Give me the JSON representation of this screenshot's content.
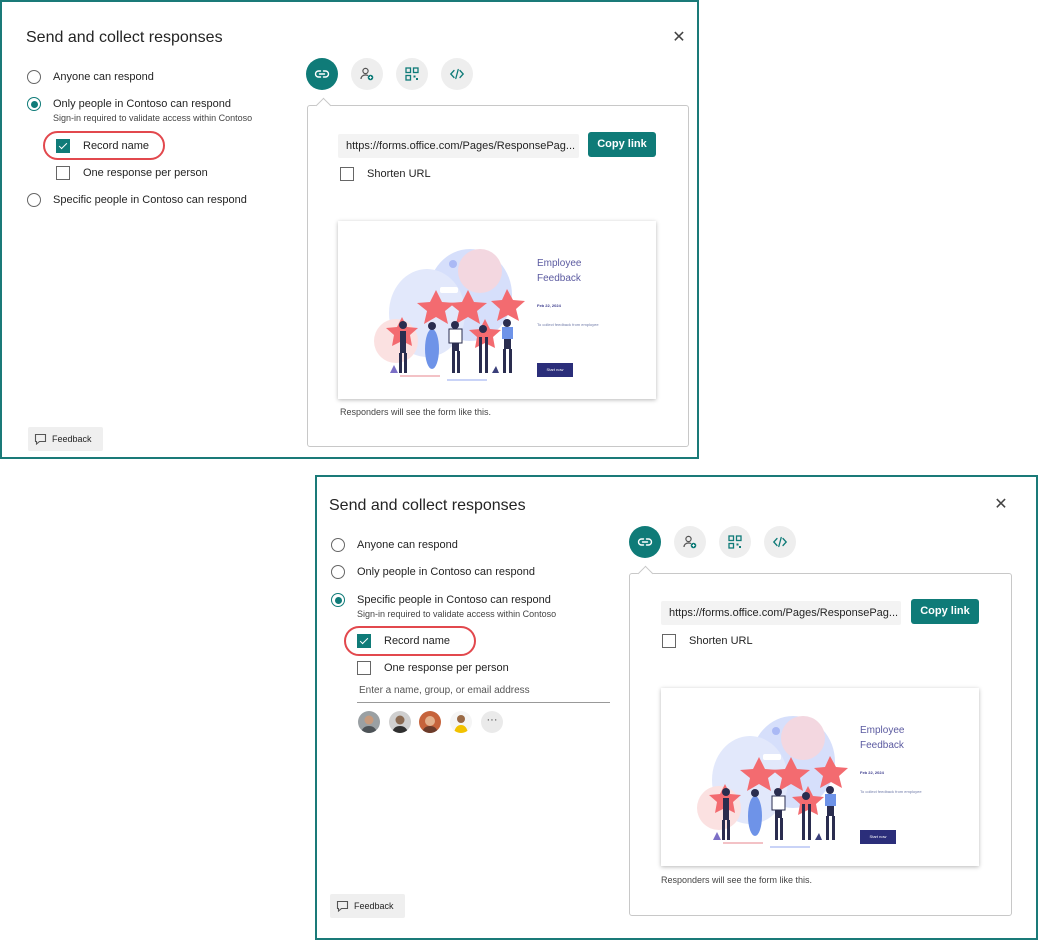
{
  "dialog": {
    "title": "Send and collect responses",
    "options": {
      "anyone": "Anyone can respond",
      "only_contoso": "Only people in Contoso can respond",
      "specific_contoso": "Specific people in Contoso can respond",
      "signin_note": "Sign-in required to validate access within Contoso"
    },
    "record_name": "Record name",
    "one_response": "One response per person",
    "people_placeholder": "Enter a name, group, or email address",
    "more_label": "···",
    "url": "https://forms.office.com/Pages/ResponsePag...",
    "url_alt": "https://forms.office.com/Pages/ResponsePage...",
    "copy_link": "Copy link",
    "shorten_url": "Shorten URL",
    "responders_note": "Responders will see the form like this.",
    "feedback": "Feedback",
    "close_glyph": "✕"
  },
  "preview": {
    "title_line1": "Employee",
    "title_line2": "Feedback",
    "date": "Feb 22, 2024",
    "description": "To collect feedback from employee",
    "start_button": "Start now"
  },
  "colors": {
    "accent": "#0f7b78",
    "frame": "#1a7a78",
    "highlight": "#e2484d"
  },
  "icons": [
    "link-icon",
    "share-people-icon",
    "qr-code-icon",
    "embed-code-icon",
    "comment-icon"
  ]
}
